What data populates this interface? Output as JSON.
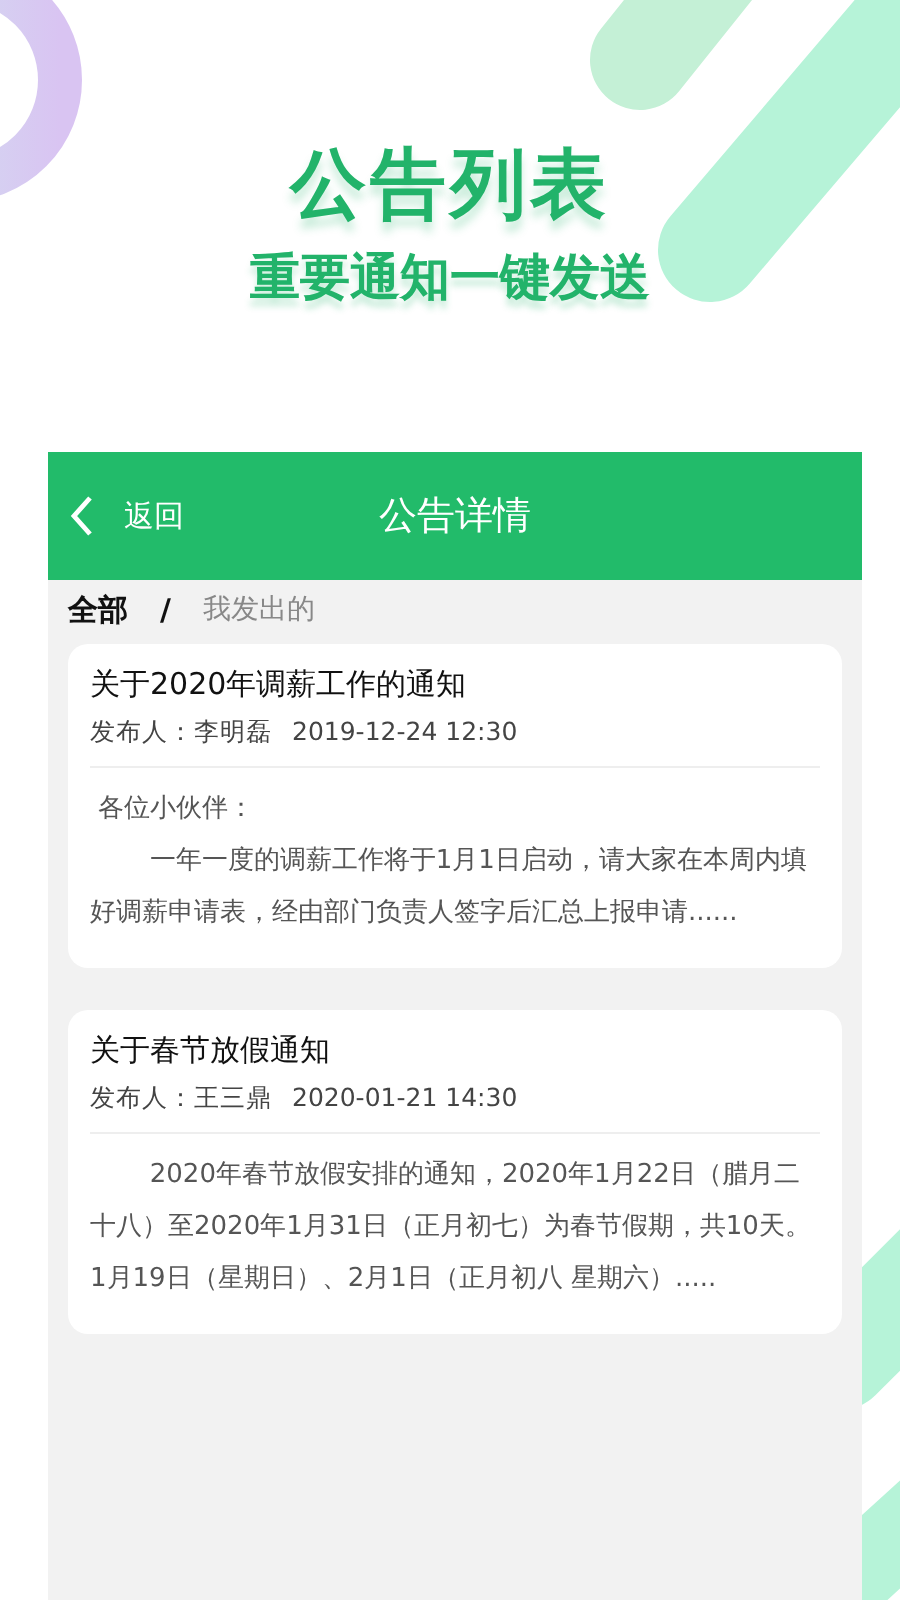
{
  "promo": {
    "title": "公告列表",
    "subtitle": "重要通知一键发送"
  },
  "nav": {
    "back_label": "返回",
    "title": "公告详情"
  },
  "filters": [
    {
      "label": "全部",
      "selected": true
    },
    {
      "label": "我发出的",
      "selected": false
    }
  ],
  "filter_separator": "/",
  "notices": [
    {
      "title": "关于2020年调薪工作的通知",
      "publisher": "发布人：李明磊",
      "time": "2019-12-24 12:30",
      "greeting": "各位小伙伴：",
      "body": "一年一度的调薪工作将于1月1日启动，请大家在本周内填好调薪申请表，经由部门负责人签字后汇总上报申请......"
    },
    {
      "title": "关于春节放假通知",
      "publisher": "发布人：王三鼎",
      "time": "2020-01-21 14:30",
      "body": "2020年春节放假安排的通知，2020年1月22日（腊月二十八）至2020年1月31日（正月初七）为春节假期，共10天。1月19日（星期日）、2月1日（正月初八 星期六）....."
    }
  ]
}
